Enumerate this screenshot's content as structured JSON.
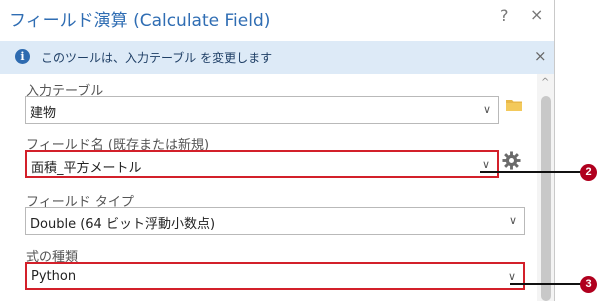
{
  "dialog": {
    "title": "フィールド演算 (Calculate Field)",
    "help_label": "?",
    "close_label": "×"
  },
  "banner": {
    "icon_glyph": "i",
    "text": "このツールは、入力テーブル を変更します",
    "close_label": "×"
  },
  "fields": [
    {
      "label": "入力テーブル",
      "value": "建物",
      "chevron": "∨"
    },
    {
      "label": "フィールド名 (既存または新規)",
      "value": "面積_平方メートル",
      "chevron": "∨"
    },
    {
      "label": "フィールド タイプ",
      "value": "Double (64 ビット浮動小数点)",
      "chevron": "∨"
    },
    {
      "label": "式の種類",
      "value": "Python",
      "chevron": "∨"
    }
  ],
  "scrollbar": {
    "up_glyph": "^"
  },
  "callouts": [
    {
      "number": "2"
    },
    {
      "number": "3"
    }
  ],
  "colors": {
    "title": "#2f6db3",
    "banner_bg": "#ddeaf7",
    "highlight_border": "#d3202a",
    "badge": "#b0001e"
  }
}
